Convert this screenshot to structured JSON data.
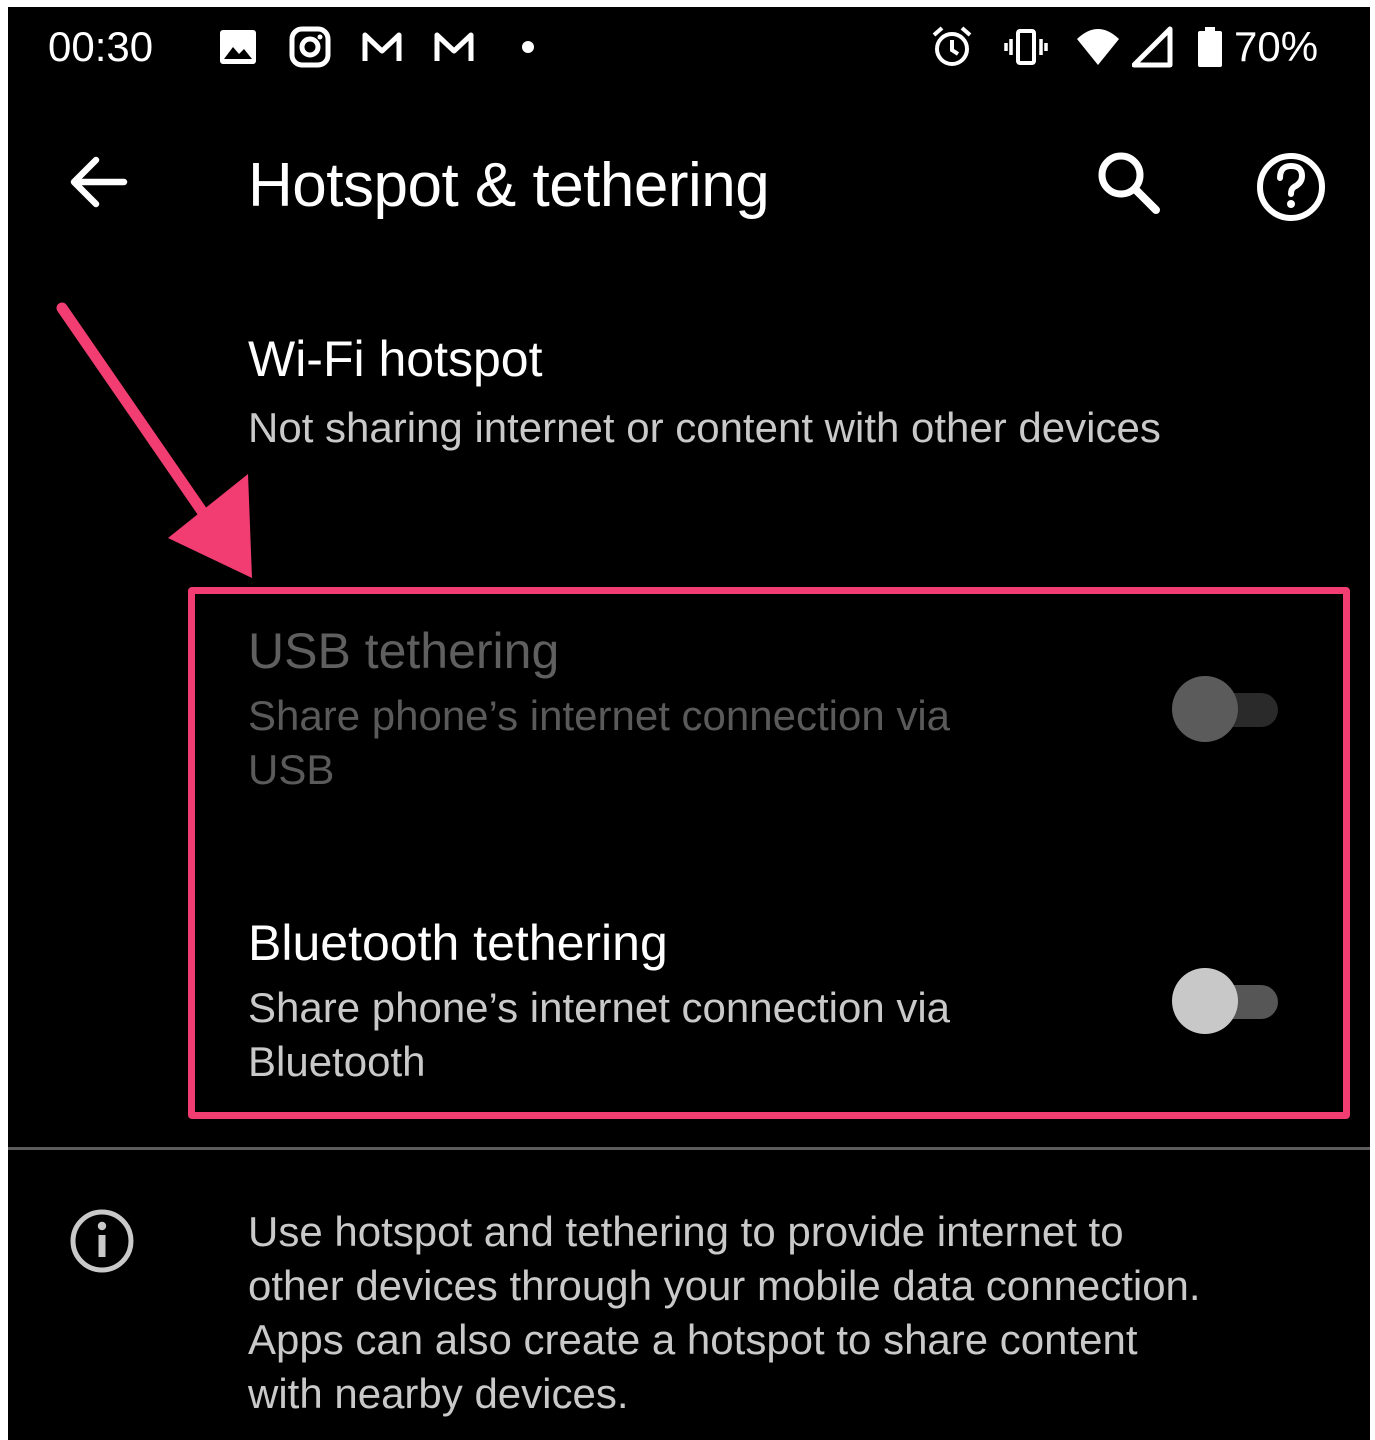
{
  "status_bar": {
    "time": "00:30",
    "notification_icons": [
      "image-icon",
      "instagram-icon",
      "gmail-icon",
      "gmail-icon",
      "more-dot-icon"
    ],
    "system_icons": [
      "alarm-icon",
      "vibrate-icon",
      "wifi-icon",
      "cell-signal-icon",
      "battery-icon"
    ],
    "battery_percent": "70%"
  },
  "app_bar": {
    "title": "Hotspot & tethering",
    "back_icon": "back-arrow-icon",
    "search_icon": "search-icon",
    "help_icon": "help-icon"
  },
  "items": [
    {
      "title": "Wi-Fi hotspot",
      "summary": "Not sharing internet or content with other devices",
      "enabled": true
    },
    {
      "title": "USB tethering",
      "summary_line1": "Share phone’s internet connection via",
      "summary_line2": "USB",
      "enabled": false,
      "toggle_on": false
    },
    {
      "title": "Bluetooth tethering",
      "summary_line1": "Share phone’s internet connection via",
      "summary_line2": "Bluetooth",
      "enabled": true,
      "toggle_on": false
    }
  ],
  "footer": {
    "icon": "info-icon",
    "text_line1": "Use hotspot and tethering to provide internet to",
    "text_line2": "other devices through your mobile data connection.",
    "text_line3": "Apps can also create a hotspot to share content",
    "text_line4": "with nearby devices."
  },
  "annotation": {
    "color": "#f23d72"
  },
  "colors": {
    "background": "#000000",
    "primary_text": "#ffffff",
    "secondary_text": "#c9c9c9",
    "disabled_text": "#5f5f5f"
  }
}
